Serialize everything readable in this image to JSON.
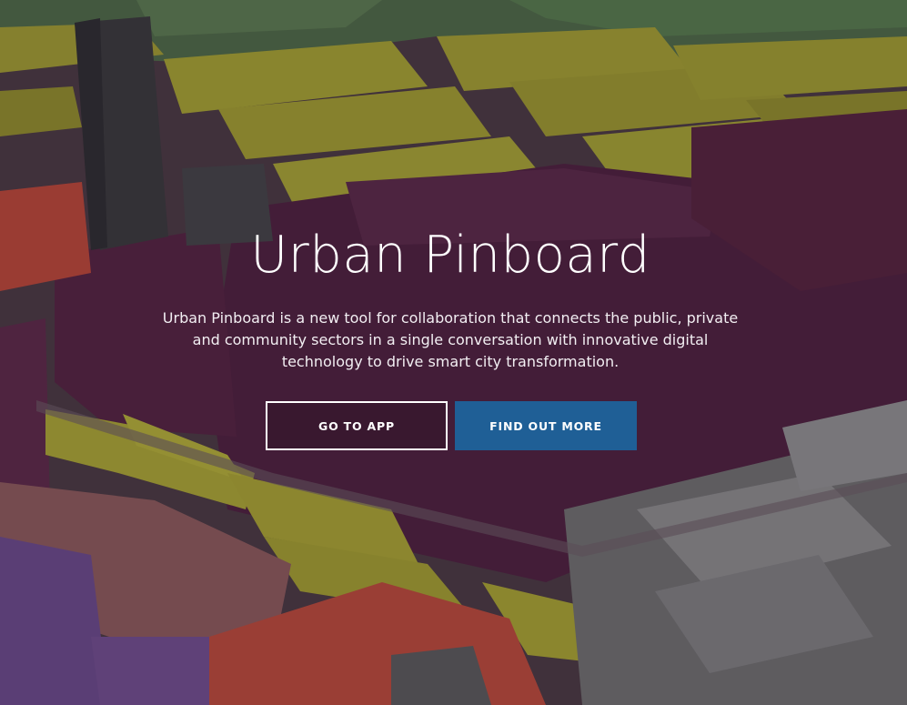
{
  "hero": {
    "title": "Urban Pinboard",
    "description": "Urban Pinboard is a new tool for collaboration that connects the public, private and community sectors in a single conversation with innovative digital technology to drive smart city transformation.",
    "background_icon": "city-3d-map-illustration"
  },
  "actions": {
    "go_to_app_label": "GO TO APP",
    "find_out_more_label": "FIND OUT MORE"
  },
  "colors": {
    "accent": "#1f5f96",
    "text": "#ffffff",
    "zone_residential": "#a8a532",
    "zone_commercial": "#5e2a4a",
    "zone_park": "#4f7a4e",
    "zone_industrial": "#b84a3c",
    "zone_institutional": "#6a4a8a",
    "buildings_generic": "#7c7c7c"
  }
}
